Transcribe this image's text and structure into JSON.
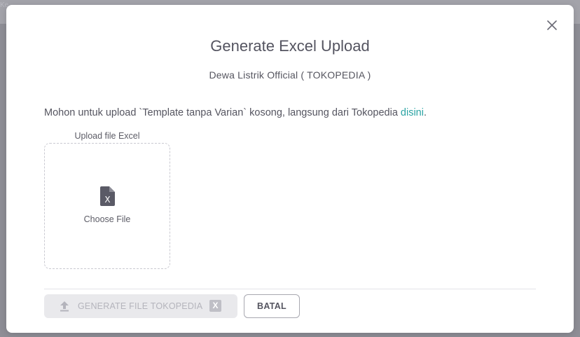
{
  "backdrop": {
    "faint_text": "Ke"
  },
  "modal": {
    "title": "Generate Excel Upload",
    "subtitle": "Dewa Listrik Official ( TOKOPEDIA )",
    "instruction_text": "Mohon untuk upload `Template tanpa Varian` kosong, langsung dari Tokopedia ",
    "instruction_link": "disini",
    "instruction_end": ".",
    "upload": {
      "label": "Upload file Excel",
      "choose_text": "Choose File",
      "icon": "excel-file-icon"
    },
    "actions": {
      "generate_label": "GENERATE FILE TOKOPEDIA",
      "generate_badge": "X",
      "generate_icon": "upload-icon",
      "cancel_label": "BATAL"
    },
    "close_icon": "close-icon"
  },
  "colors": {
    "link": "#2aa3a3",
    "disabled_bg": "#e9e9ec",
    "disabled_text": "#b4b4bc",
    "icon_dark": "#5a5a66"
  }
}
